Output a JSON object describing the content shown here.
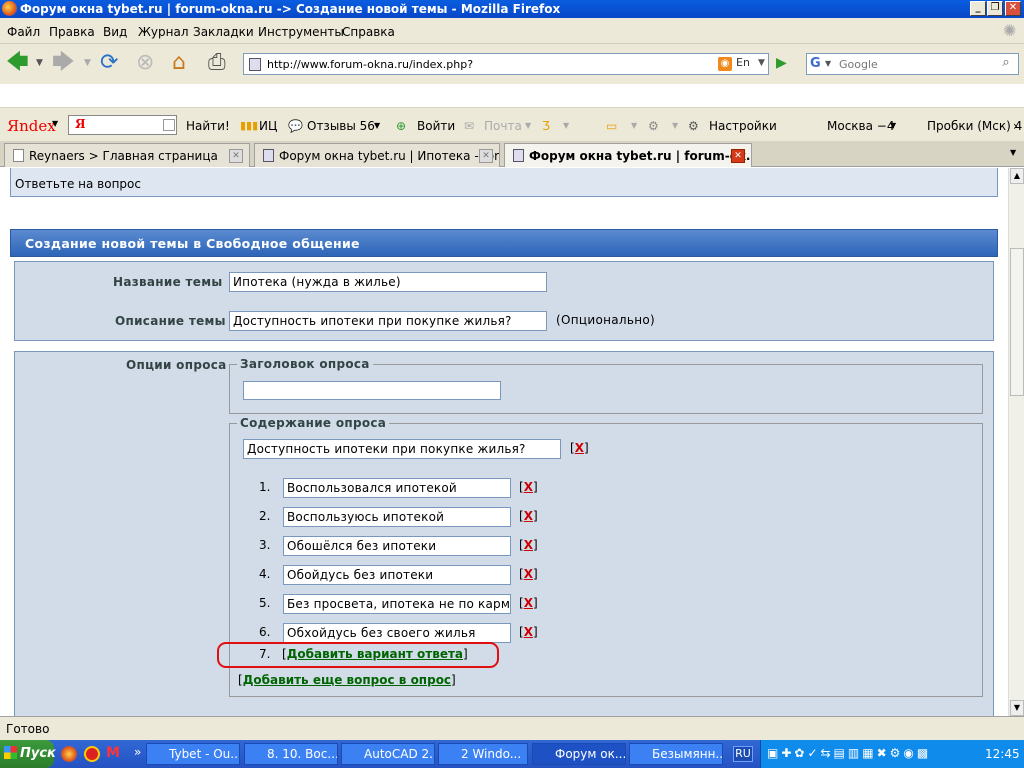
{
  "window": {
    "title": "Форум окна tybet.ru | forum-okna.ru -> Создание новой темы - Mozilla Firefox"
  },
  "menu": [
    "Файл",
    "Правка",
    "Вид",
    "Журнал",
    "Закладки",
    "Инструменты",
    "Справка"
  ],
  "nav": {
    "url": "http://www.forum-okna.ru/index.php?",
    "lang_badge": "En",
    "search_placeholder": "Google"
  },
  "yandex_bar": {
    "logo": "Яndex",
    "input_value": "Я",
    "find": "Найти!",
    "ic": "ИЦ",
    "reviews": "Отзывы 56",
    "login": "Войти",
    "mail": "Почта",
    "settings": "Настройки",
    "weather": "Москва −4",
    "traffic": "Пробки (Мск) 4"
  },
  "tabs": [
    {
      "label": "Reynaers > Главная страница"
    },
    {
      "label": "Форум окна tybet.ru | Ипотека - for..."
    },
    {
      "label": "Форум окна tybet.ru | forum-ok..."
    }
  ],
  "page": {
    "prev_prompt": "Ответьте на вопрос",
    "header": "Создание новой темы в Свободное общение",
    "topic_name_label": "Название темы",
    "topic_name_value": "Ипотека (нужда в жилье)",
    "topic_desc_label": "Описание темы",
    "topic_desc_value": "Доступность ипотеки при покупке жилья?",
    "optional": "(Опционально)",
    "poll_options_label": "Опции опроса",
    "poll_title_legend": "Заголовок опроса",
    "poll_title_value": "",
    "poll_content_legend": "Содержание опроса",
    "question": "Доступность ипотеки при покупке жилья?",
    "x_label": "X",
    "answers": [
      {
        "num": "1.",
        "text": "Воспользовался ипотекой"
      },
      {
        "num": "2.",
        "text": "Воспользуюсь ипотекой"
      },
      {
        "num": "3.",
        "text": "Обошёлся без ипотеки"
      },
      {
        "num": "4.",
        "text": "Обойдусь без ипотеки"
      },
      {
        "num": "5.",
        "text": "Без просвета, ипотека не по карману"
      },
      {
        "num": "6.",
        "text": "Обхойдусь без своего жилья"
      }
    ],
    "add_answer_num": "7.",
    "add_answer": "Добавить вариант ответа",
    "add_question": "Добавить еще вопрос в опрос"
  },
  "status": "Готово",
  "taskbar": {
    "start": "Пуск",
    "tasks": [
      "Tybet - Ou...",
      "8. 10. Вос...",
      "AutoCAD 2...",
      "2 Windo...",
      "Форум ок...",
      "Безымянн..."
    ],
    "lang": "RU",
    "clock": "12:45"
  }
}
